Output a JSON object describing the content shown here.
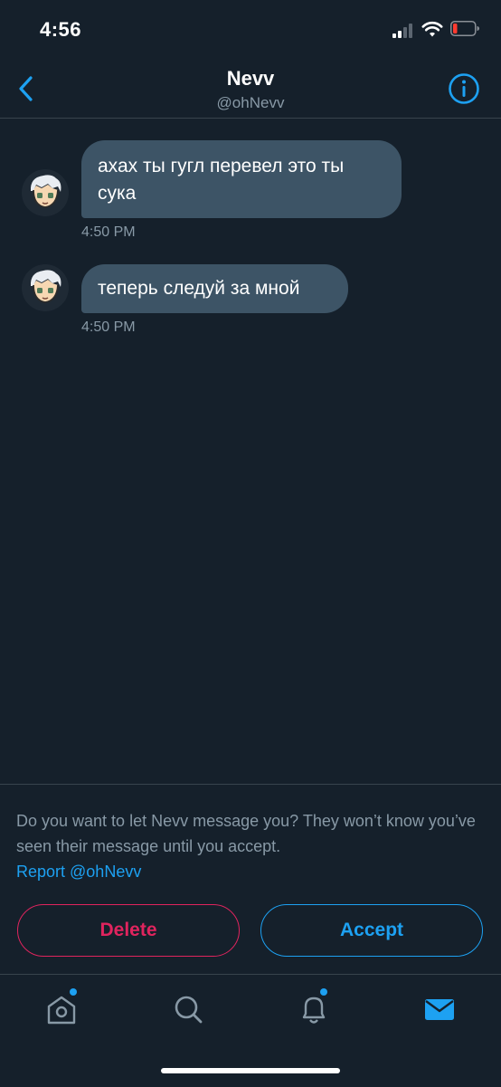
{
  "status_bar": {
    "time": "4:56"
  },
  "header": {
    "title": "Nevv",
    "handle": "@ohNevv"
  },
  "messages": [
    {
      "text": "ахах ты гугл перевел это ты сука",
      "time": "4:50 PM"
    },
    {
      "text": "теперь следуй за мной",
      "time": "4:50 PM"
    }
  ],
  "request": {
    "prompt": "Do you want to let Nevv message you? They won’t know you’ve seen their message until you accept.",
    "report_label": "Report @ohNevv",
    "delete_label": "Delete",
    "accept_label": "Accept"
  },
  "tabbar": {
    "tabs": [
      {
        "icon": "home-icon",
        "has_notification": true
      },
      {
        "icon": "search-icon",
        "has_notification": false
      },
      {
        "icon": "bell-icon",
        "has_notification": true
      },
      {
        "icon": "mail-icon",
        "active": true
      }
    ]
  },
  "colors": {
    "background": "#15202b",
    "bubble": "#3d5466",
    "accent": "#1da1f2",
    "danger": "#e0245e",
    "secondary_text": "#8899a6"
  }
}
